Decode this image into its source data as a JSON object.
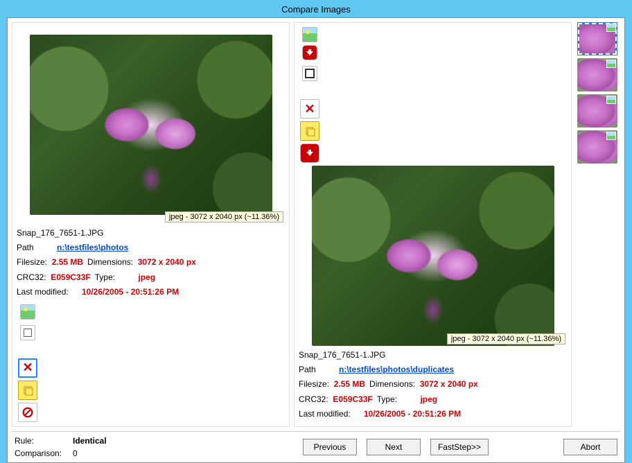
{
  "title": "Compare Images",
  "left": {
    "caption": "jpeg - 3072 x 2040 px (~11.36%)",
    "filename": "Snap_176_7651-1.JPG",
    "path_label": "Path",
    "path": "n:\\testfiles\\photos",
    "filesize_label": "Filesize:",
    "filesize": "2.55 MB",
    "dim_label": "Dimensions:",
    "dims": "3072 x 2040 px",
    "crc_label": "CRC32:",
    "crc": "E059C33F",
    "type_label": "Type:",
    "type": "jpeg",
    "mod_label": "Last modified:",
    "mod": "10/26/2005 - 20:51:26 PM"
  },
  "right": {
    "caption": "jpeg - 3072 x 2040 px (~11.36%)",
    "filename": "Snap_176_7651-1.JPG",
    "path_label": "Path",
    "path": "n:\\testfiles\\photos\\duplicates",
    "filesize_label": "Filesize:",
    "filesize": "2.55 MB",
    "dim_label": "Dimensions:",
    "dims": "3072 x 2040 px",
    "crc_label": "CRC32:",
    "crc": "E059C33F",
    "type_label": "Type:",
    "type": "jpeg",
    "mod_label": "Last modified:",
    "mod": "10/26/2005 - 20:51:26 PM"
  },
  "footer": {
    "rule_label": "Rule:",
    "rule": "Identical",
    "cmp_label": "Comparison:",
    "cmp": "0",
    "prev": "Previous",
    "next": "Next",
    "fast": "FastStep>>",
    "abort": "Abort"
  }
}
